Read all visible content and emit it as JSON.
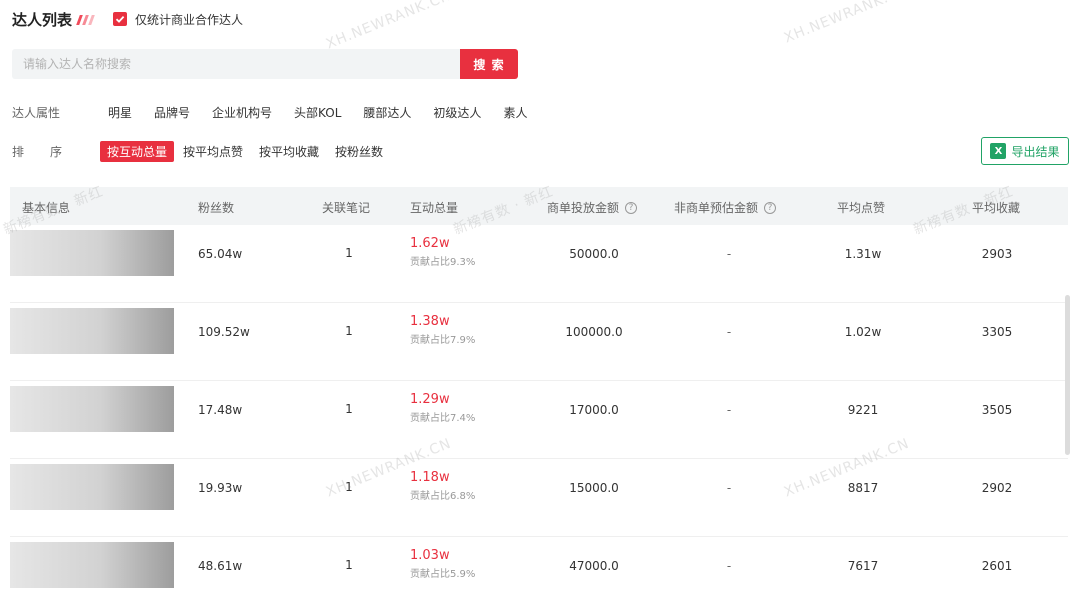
{
  "header": {
    "title": "达人列表",
    "checkbox_label": "仅统计商业合作达人",
    "checked": true
  },
  "search": {
    "placeholder": "请输入达人名称搜索",
    "button_label": "搜 索"
  },
  "attributes": {
    "label": "达人属性",
    "options": [
      "明星",
      "品牌号",
      "企业机构号",
      "头部KOL",
      "腰部达人",
      "初级达人",
      "素人"
    ]
  },
  "sort": {
    "label_a": "排",
    "label_b": "序",
    "options": [
      "按互动总量",
      "按平均点赞",
      "按平均收藏",
      "按粉丝数"
    ],
    "active_index": 0
  },
  "export": {
    "icon_letter": "X",
    "label": "导出结果"
  },
  "table": {
    "headers": {
      "basic": "基本信息",
      "fans": "粉丝数",
      "notes": "关联笔记",
      "interaction": "互动总量",
      "commercial_amount": "商单投放金额",
      "non_commercial_amount": "非商单预估金额",
      "avg_likes": "平均点赞",
      "avg_collects": "平均收藏"
    },
    "rows": [
      {
        "fans": "65.04w",
        "notes": "1",
        "interaction": "1.62w",
        "share": "贡献占比9.3%",
        "commercial": "50000.0",
        "non_commercial": "-",
        "avg_likes": "1.31w",
        "avg_collects": "2903"
      },
      {
        "fans": "109.52w",
        "notes": "1",
        "interaction": "1.38w",
        "share": "贡献占比7.9%",
        "commercial": "100000.0",
        "non_commercial": "-",
        "avg_likes": "1.02w",
        "avg_collects": "3305"
      },
      {
        "fans": "17.48w",
        "notes": "1",
        "interaction": "1.29w",
        "share": "贡献占比7.4%",
        "commercial": "17000.0",
        "non_commercial": "-",
        "avg_likes": "9221",
        "avg_collects": "3505"
      },
      {
        "fans": "19.93w",
        "notes": "1",
        "interaction": "1.18w",
        "share": "贡献占比6.8%",
        "commercial": "15000.0",
        "non_commercial": "-",
        "avg_likes": "8817",
        "avg_collects": "2902"
      },
      {
        "fans": "48.61w",
        "notes": "1",
        "interaction": "1.03w",
        "share": "贡献占比5.9%",
        "commercial": "47000.0",
        "non_commercial": "-",
        "avg_likes": "7617",
        "avg_collects": "2601"
      }
    ]
  },
  "watermarks": {
    "site": "XH.NEWRANK.CN",
    "brand": "新榜有数 · 新红"
  },
  "colors": {
    "accent": "#e8303f",
    "excel_green": "#21a366",
    "header_bg": "#f2f4f5"
  }
}
